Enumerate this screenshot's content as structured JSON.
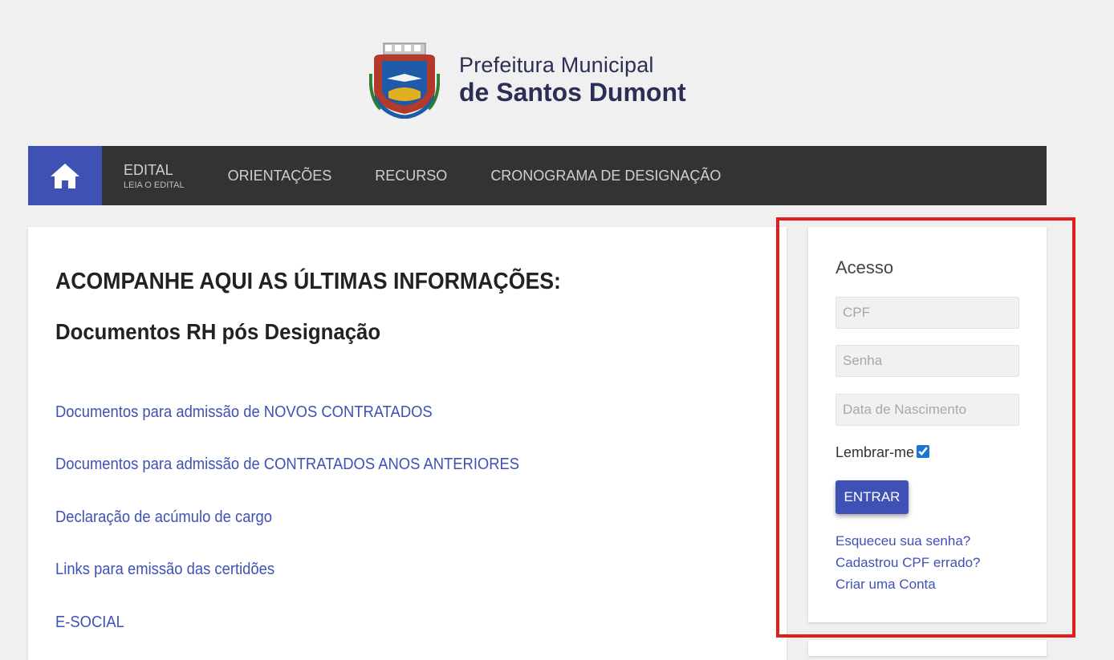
{
  "header": {
    "logo_line1": "Prefeitura Municipal",
    "logo_line2": "de Santos Dumont",
    "seal_icon": "municipal-coat-of-arms"
  },
  "nav": {
    "home_icon": "home-icon",
    "items": [
      {
        "label": "EDITAL",
        "sublabel": "LEIA O EDITAL"
      },
      {
        "label": "ORIENTAÇÕES"
      },
      {
        "label": "RECURSO"
      },
      {
        "label": "CRONOGRAMA DE DESIGNAÇÃO"
      }
    ],
    "colors": {
      "bar": "#333333",
      "home": "#3f51b5"
    }
  },
  "main": {
    "title": "ACOMPANHE AQUI AS ÚLTIMAS INFORMAÇÕES:",
    "subtitle": "Documentos RH pós Designação",
    "links": [
      "Documentos para admissão de NOVOS CONTRATADOS",
      "Documentos para admissão de CONTRATADOS ANOS ANTERIORES",
      "Declaração de acúmulo de cargo",
      "Links para emissão das certidões",
      "E-SOCIAL"
    ]
  },
  "login": {
    "title": "Acesso",
    "cpf_placeholder": "CPF",
    "password_placeholder": "Senha",
    "birthdate_placeholder": "Data de Nascimento",
    "remember_label": "Lembrar-me",
    "remember_checked": true,
    "submit_label": "ENTRAR",
    "forgot_password": "Esqueceu sua senha?",
    "wrong_cpf": "Cadastrou CPF errado?",
    "create_account": "Criar uma Conta"
  },
  "colors": {
    "accent": "#3f51b5",
    "highlight": "#e31c1c",
    "background": "#f0f0f0"
  }
}
